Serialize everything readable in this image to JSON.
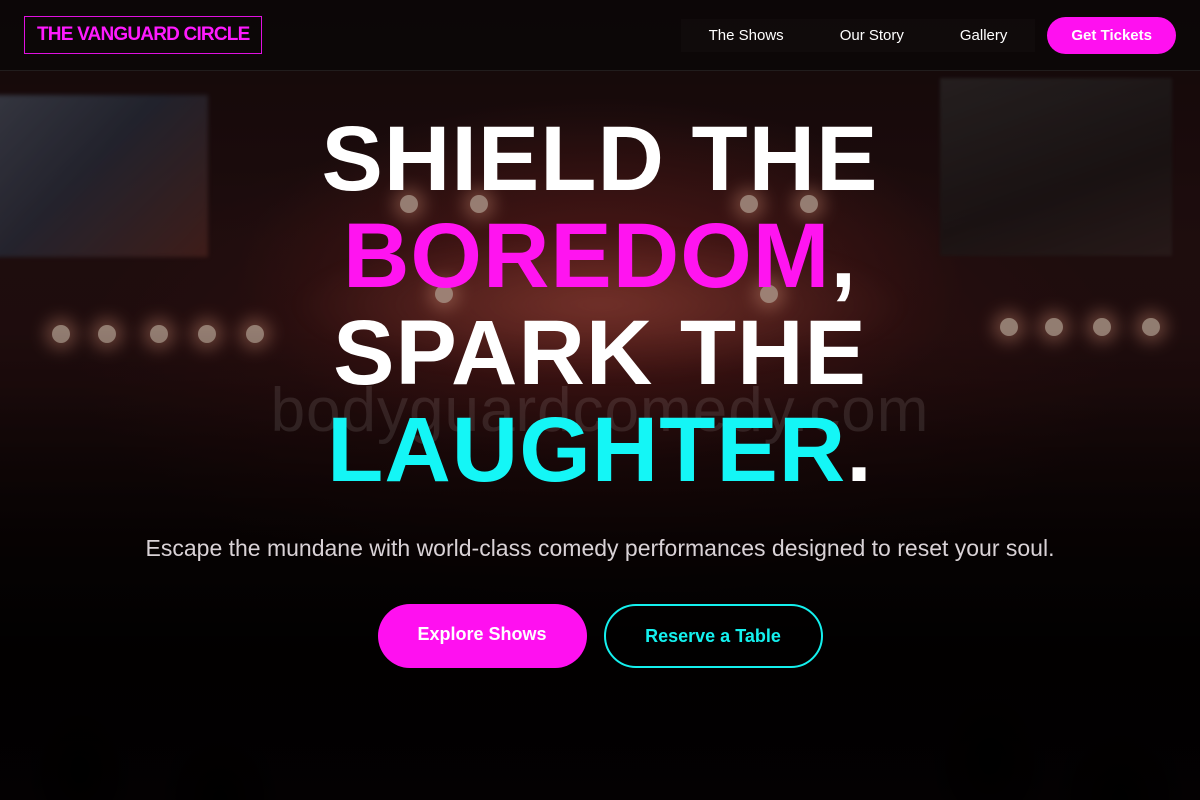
{
  "brand": {
    "logo_text": "THE VANGUARD CIRCLE"
  },
  "nav": {
    "links": [
      {
        "label": "The Shows"
      },
      {
        "label": "Our Story"
      },
      {
        "label": "Gallery"
      }
    ],
    "cta_label": "Get Tickets"
  },
  "hero": {
    "headline": {
      "line1": "SHIELD THE",
      "line2_highlight": "BOREDOM",
      "line2_punct": ",",
      "line3": "SPARK THE",
      "line4_highlight": "LAUGHTER",
      "line4_punct": "."
    },
    "subtitle": "Escape the mundane with world-class comedy performances designed to reset your soul.",
    "primary_button": "Explore Shows",
    "secondary_button": "Reserve a Table"
  },
  "watermark": "bodyguardcomedy.com",
  "colors": {
    "accent_pink": "#ff10f0",
    "accent_cyan": "#14f6f6",
    "header_bg": "#0a0607"
  }
}
